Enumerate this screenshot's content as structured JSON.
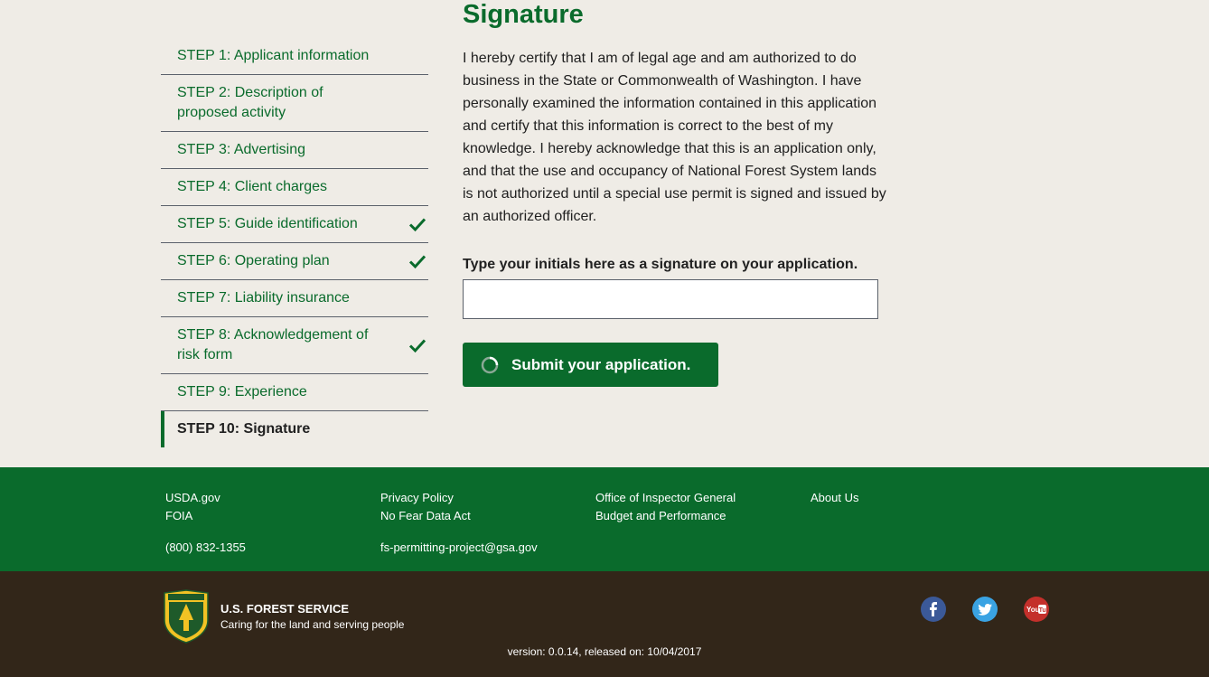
{
  "sidenav": {
    "items": [
      {
        "label": "STEP 1: Applicant information"
      },
      {
        "label": "STEP 2: Description of proposed activity"
      },
      {
        "label": "STEP 3: Advertising"
      },
      {
        "label": "STEP 4: Client charges"
      },
      {
        "label": "STEP 5: Guide identification"
      },
      {
        "label": "STEP 6: Operating plan"
      },
      {
        "label": "STEP 7: Liability insurance"
      },
      {
        "label": "STEP 8: Acknowledgement of risk form"
      },
      {
        "label": "STEP 9: Experience"
      },
      {
        "label": "STEP 10: Signature"
      }
    ],
    "completed_icon": "checkmark-icon"
  },
  "main": {
    "title": "Signature",
    "certification": "I hereby certify that I am of legal age and am authorized to do business in the State or Commonwealth of Washington. I have personally examined the information contained in this application and certify that this information is correct to the best of my knowledge. I hereby acknowledge that this is an application only, and that the use and occupancy of National Forest System lands is not authorized until a special use permit is signed and issued by an authorized officer.",
    "signature_label": "Type your initials here as a signature on your application.",
    "signature_value": "",
    "submit_label": "Submit your application."
  },
  "footer": {
    "col1": {
      "a": "USDA.gov",
      "b": "FOIA",
      "c": "(800) 832-1355"
    },
    "col2": {
      "a": "Privacy Policy",
      "b": "No Fear Data Act",
      "c": "fs-permitting-project@gsa.gov"
    },
    "col3": {
      "a": "Office of Inspector General",
      "b": "Budget and Performance"
    },
    "col4": {
      "a": "About Us"
    },
    "brand_name": "U.S. FOREST SERVICE",
    "brand_tagline": "Caring for the land and serving people",
    "version": "version: 0.0.14, released on: 10/04/2017"
  },
  "colors": {
    "primary_green": "#0a6b2c",
    "footer_brown": "#322619",
    "background": "#efece6"
  }
}
